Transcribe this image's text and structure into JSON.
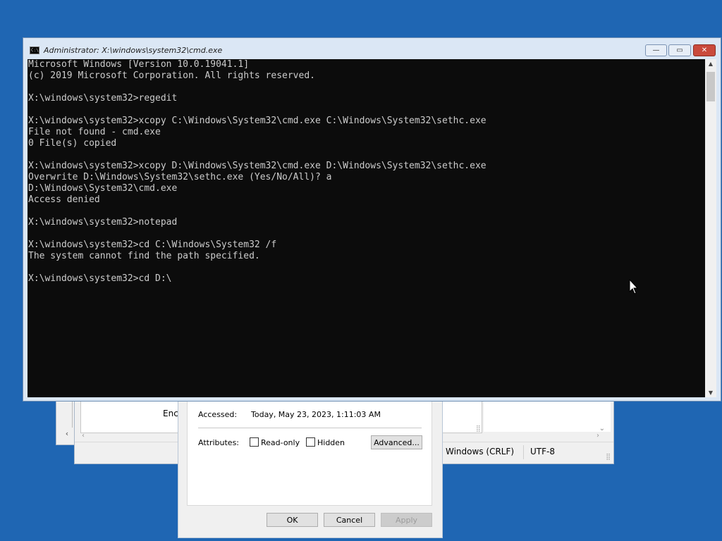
{
  "cmd": {
    "title": "Administrator: X:\\windows\\system32\\cmd.exe",
    "icon_label": "C:\\",
    "minimize": "—",
    "maximize": "▭",
    "close": "✕",
    "lines": [
      "Microsoft Windows [Version 10.0.19041.1]",
      "(c) 2019 Microsoft Corporation. All rights reserved.",
      "",
      "X:\\windows\\system32>regedit",
      "",
      "X:\\windows\\system32>xcopy C:\\Windows\\System32\\cmd.exe C:\\Windows\\System32\\sethc.exe",
      "File not found - cmd.exe",
      "0 File(s) copied",
      "",
      "X:\\windows\\system32>xcopy D:\\Windows\\System32\\cmd.exe D:\\Windows\\System32\\sethc.exe",
      "Overwrite D:\\Windows\\System32\\sethc.exe (Yes/No/All)? a",
      "D:\\Windows\\System32\\cmd.exe",
      "Access denied",
      "",
      "X:\\windows\\system32>notepad",
      "",
      "X:\\windows\\system32>cd C:\\Windows\\System32 /f",
      "The system cannot find the path specified.",
      "",
      "X:\\windows\\system32>cd D:\\"
    ],
    "colors": {
      "background": "#0c0c0c",
      "text": "#cccccc"
    }
  },
  "notepad": {
    "encoding_label": "Encod",
    "line_ending": "Windows (CRLF)",
    "encoding": "UTF-8"
  },
  "properties": {
    "accessed_label": "Accessed:",
    "accessed_value": "Today, May 23, 2023, 1:11:03 AM",
    "attributes_label": "Attributes:",
    "readonly_label": "Read-only",
    "readonly_checked": false,
    "hidden_label": "Hidden",
    "hidden_checked": false,
    "advanced_button": "Advanced...",
    "ok_button": "OK",
    "cancel_button": "Cancel",
    "apply_button": "Apply"
  },
  "desktop": {
    "background": "#1f66b3"
  }
}
